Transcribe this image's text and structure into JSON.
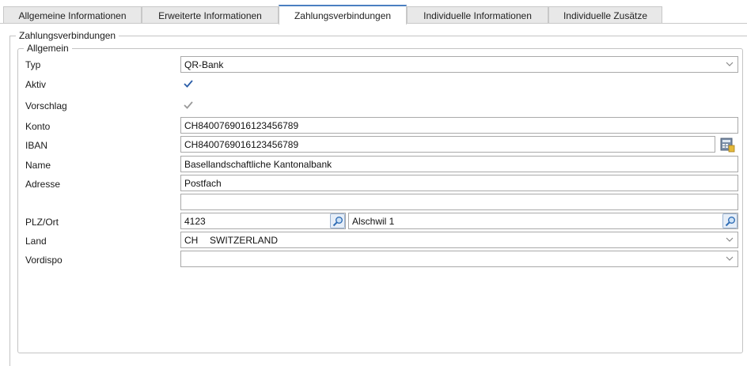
{
  "tabs": [
    {
      "label": "Allgemeine Informationen",
      "active": false
    },
    {
      "label": "Erweiterte Informationen",
      "active": false
    },
    {
      "label": "Zahlungsverbindungen",
      "active": true
    },
    {
      "label": "Individuelle Informationen",
      "active": false
    },
    {
      "label": "Individuelle Zusätze",
      "active": false
    }
  ],
  "group": {
    "title": "Zahlungsverbindungen",
    "section_title": "Allgemein"
  },
  "form": {
    "typ": {
      "label": "Typ",
      "value": "QR-Bank"
    },
    "aktiv": {
      "label": "Aktiv",
      "checked": true
    },
    "vorschlag": {
      "label": "Vorschlag",
      "checked": true,
      "disabled": true
    },
    "konto": {
      "label": "Konto",
      "value": "CH8400769016123456789"
    },
    "iban": {
      "label": "IBAN",
      "value": "CH8400769016123456789"
    },
    "name": {
      "label": "Name",
      "value": "Basellandschaftliche Kantonalbank"
    },
    "adresse": {
      "label": "Adresse",
      "value": "Postfach",
      "value2": ""
    },
    "plz_ort": {
      "label": "PLZ/Ort",
      "plz": "4123",
      "ort": "Alschwil 1"
    },
    "land": {
      "label": "Land",
      "code": "CH",
      "name": "SWITZERLAND"
    },
    "vordispo": {
      "label": "Vordispo",
      "value": ""
    }
  },
  "colors": {
    "accent": "#4a7fc1",
    "checkmark": "#2b5ea8",
    "checkmark_disabled": "#9a9a9a"
  },
  "icons": {
    "lookup": "magnifier-icon",
    "iban": "iban-calculator-icon",
    "dropdown": "chevron-down-icon"
  }
}
